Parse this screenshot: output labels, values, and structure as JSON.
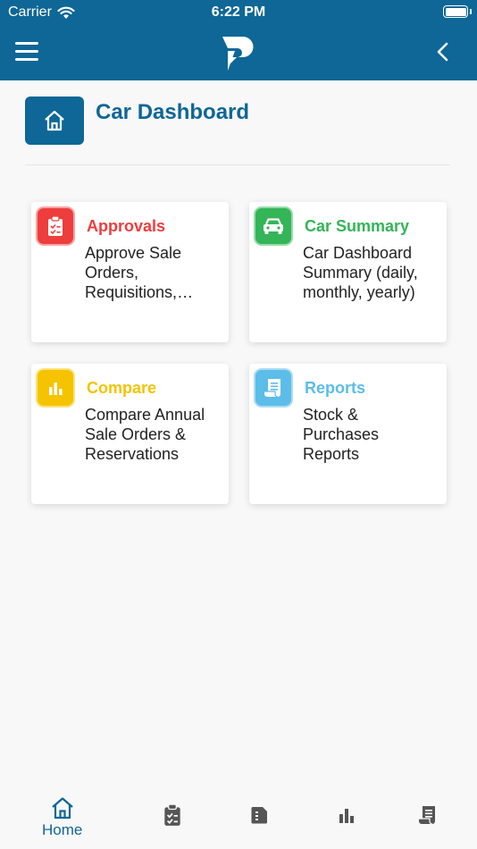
{
  "status_bar": {
    "carrier": "Carrier",
    "time": "6:22 PM"
  },
  "header": {
    "menu_icon": "hamburger-icon",
    "logo_icon": "p-logo",
    "back_icon": "chevron-left-icon"
  },
  "page": {
    "title": "Car Dashboard",
    "home_icon": "home-icon"
  },
  "colors": {
    "brand": "#0e6796",
    "approvals": "#ee3d3d",
    "car_summary": "#33b558",
    "compare": "#f5c300",
    "reports": "#5bbde8"
  },
  "cards": [
    {
      "title": "Approvals",
      "description": "Approve Sale Orders, Requisitions, Rejections",
      "icon": "clipboard-check-icon"
    },
    {
      "title": "Car Summary",
      "description": "Car Dashboard Summary (daily, monthly, yearly)",
      "icon": "car-icon"
    },
    {
      "title": "Compare",
      "description": "Compare Annual Sale Orders & Reservations",
      "icon": "bar-chart-icon"
    },
    {
      "title": "Reports",
      "description": "Stock & Purchases Reports",
      "icon": "receipt-icon"
    }
  ],
  "tabbar": {
    "home_label": "Home",
    "tabs": [
      "home-icon",
      "clipboard-check-icon",
      "document-icon",
      "bar-chart-icon",
      "receipt-icon"
    ]
  }
}
